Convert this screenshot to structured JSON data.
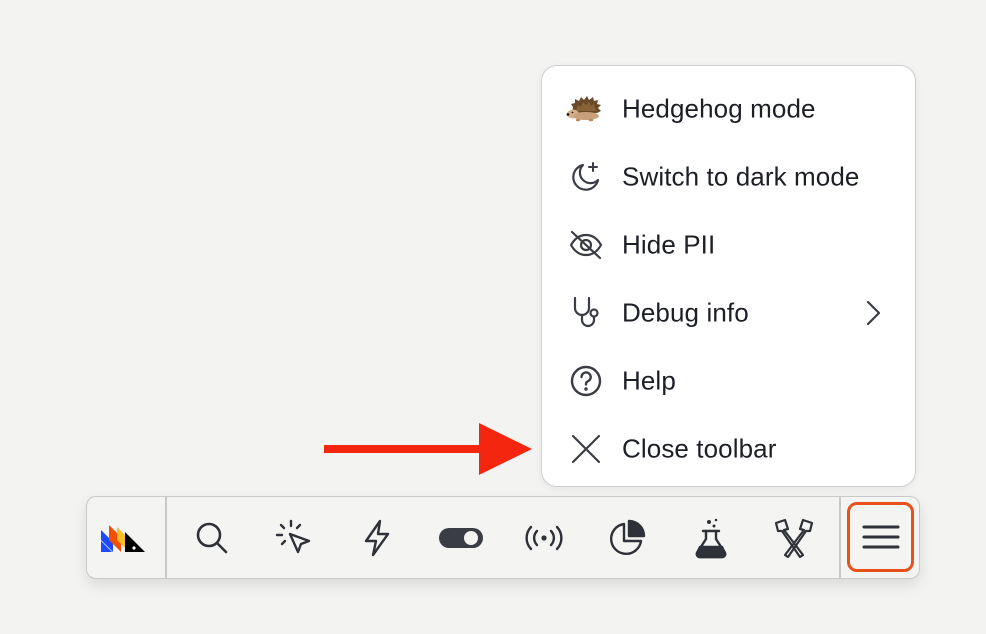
{
  "menu": {
    "items": [
      {
        "label": "Hedgehog mode",
        "icon": "hedgehog-icon",
        "has_submenu": false
      },
      {
        "label": "Switch to dark mode",
        "icon": "moon-sparkle-icon",
        "has_submenu": false
      },
      {
        "label": "Hide PII",
        "icon": "eye-off-icon",
        "has_submenu": false
      },
      {
        "label": "Debug info",
        "icon": "stethoscope-icon",
        "has_submenu": true
      },
      {
        "label": "Help",
        "icon": "help-circle-icon",
        "has_submenu": false
      },
      {
        "label": "Close toolbar",
        "icon": "close-icon",
        "has_submenu": false
      }
    ]
  },
  "toolbar": {
    "buttons": [
      {
        "icon": "posthog-logo-icon"
      },
      {
        "icon": "search-icon"
      },
      {
        "icon": "cursor-click-icon"
      },
      {
        "icon": "lightning-icon"
      },
      {
        "icon": "toggle-icon"
      },
      {
        "icon": "broadcast-icon"
      },
      {
        "icon": "pie-chart-icon"
      },
      {
        "icon": "flask-icon"
      },
      {
        "icon": "crossed-pins-icon"
      },
      {
        "icon": "hamburger-menu-icon"
      }
    ]
  },
  "annotation": {
    "arrow_color": "#f5260f",
    "highlight_color": "#e8511a"
  },
  "colors": {
    "background": "#f3f3f2",
    "menu_bg": "#ffffff",
    "text": "#1d1f27"
  }
}
